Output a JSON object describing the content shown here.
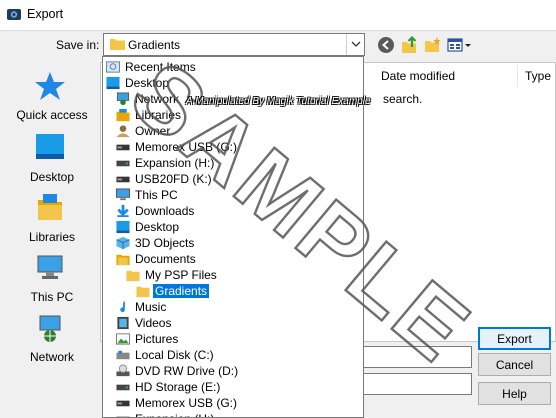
{
  "window": {
    "title": "Export"
  },
  "toolbar": {
    "save_in_label": "Save in:",
    "save_in_value": "Gradients"
  },
  "places": [
    {
      "label": "Quick access",
      "icon": "quick-access-star-icon"
    },
    {
      "label": "Desktop",
      "icon": "desktop-icon"
    },
    {
      "label": "Libraries",
      "icon": "libraries-icon"
    },
    {
      "label": "This PC",
      "icon": "this-pc-icon"
    },
    {
      "label": "Network",
      "icon": "network-icon"
    }
  ],
  "file_list": {
    "columns": [
      "Date modified",
      "Type"
    ],
    "empty_message": "search."
  },
  "buttons": {
    "export": "Export",
    "cancel": "Cancel",
    "help": "Help"
  },
  "dropdown": {
    "items": [
      {
        "label": "Recent Items",
        "icon": "recent-items-icon",
        "level": 0
      },
      {
        "label": "Desktop",
        "icon": "desktop-icon",
        "level": 0
      },
      {
        "label": "Network",
        "icon": "network-icon",
        "level": 1
      },
      {
        "label": "Libraries",
        "icon": "libraries-icon",
        "level": 1
      },
      {
        "label": "Owner",
        "icon": "user-icon",
        "level": 1
      },
      {
        "label": "Memorex USB (G:)",
        "icon": "usb-drive-icon",
        "level": 1
      },
      {
        "label": "Expansion (H:)",
        "icon": "drive-icon",
        "level": 1
      },
      {
        "label": "USB20FD (K:)",
        "icon": "usb-drive-icon",
        "level": 1
      },
      {
        "label": "This PC",
        "icon": "this-pc-icon",
        "level": 1
      },
      {
        "label": "Downloads",
        "icon": "downloads-icon",
        "level": 2
      },
      {
        "label": "Desktop",
        "icon": "desktop-icon",
        "level": 2
      },
      {
        "label": "3D Objects",
        "icon": "3d-objects-icon",
        "level": 2
      },
      {
        "label": "Documents",
        "icon": "documents-icon",
        "level": 2
      },
      {
        "label": "My PSP Files",
        "icon": "folder-icon",
        "level": 3
      },
      {
        "label": "Gradients",
        "icon": "folder-icon",
        "level": 4,
        "selected": true
      },
      {
        "label": "Music",
        "icon": "music-icon",
        "level": 2
      },
      {
        "label": "Videos",
        "icon": "videos-icon",
        "level": 2
      },
      {
        "label": "Pictures",
        "icon": "pictures-icon",
        "level": 2
      },
      {
        "label": "Local Disk (C:)",
        "icon": "local-disk-icon",
        "level": 2
      },
      {
        "label": "DVD RW Drive (D:)",
        "icon": "dvd-drive-icon",
        "level": 2
      },
      {
        "label": "HD Storage (E:)",
        "icon": "drive-icon",
        "level": 2
      },
      {
        "label": "Memorex USB (G:)",
        "icon": "usb-drive-icon",
        "level": 2
      },
      {
        "label": "Expansion (H:)",
        "icon": "drive-icon",
        "level": 2
      }
    ]
  },
  "watermark": {
    "text": "SAMPLE",
    "caption": "A Manipulated By Magik Tutorial Example"
  },
  "colors": {
    "accent": "#0078d7",
    "folder": "#f3c54a"
  }
}
